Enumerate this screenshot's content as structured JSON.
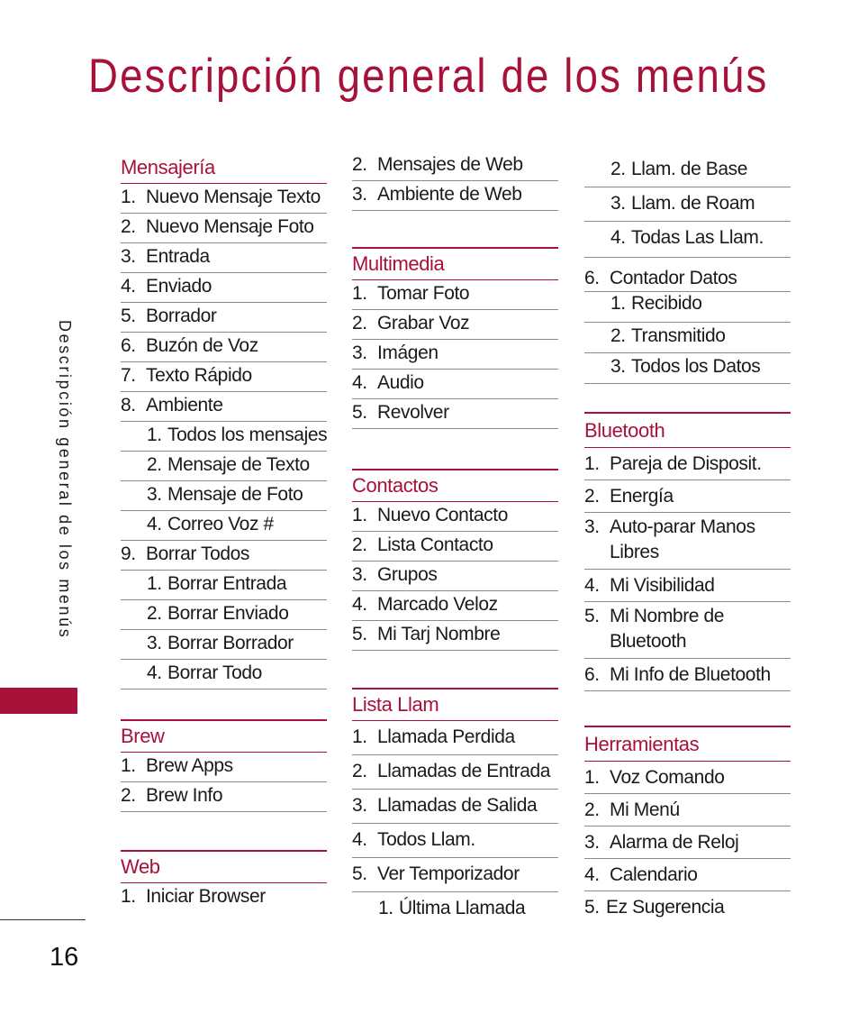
{
  "page": {
    "title": "Descripción general de los menús",
    "side_label": "Descripción general de los menús",
    "page_number": "16",
    "accent_color": "#a8123a"
  },
  "sections": {
    "mensajeria": {
      "title": "Mensajería",
      "items": [
        {
          "num": "1.",
          "label": "Nuevo Mensaje Texto"
        },
        {
          "num": "2.",
          "label": "Nuevo Mensaje Foto"
        },
        {
          "num": "3.",
          "label": "Entrada"
        },
        {
          "num": "4.",
          "label": "Enviado"
        },
        {
          "num": "5.",
          "label": "Borrador"
        },
        {
          "num": "6.",
          "label": "Buzón de Voz"
        },
        {
          "num": "7.",
          "label": "Texto Rápido"
        },
        {
          "num": "8.",
          "label": "Ambiente"
        },
        {
          "num": "1.",
          "label": "Todos los mensajes"
        },
        {
          "num": "2.",
          "label": "Mensaje de Texto"
        },
        {
          "num": "3.",
          "label": "Mensaje de Foto"
        },
        {
          "num": "4.",
          "label": "Correo Voz #"
        },
        {
          "num": "9.",
          "label": "Borrar Todos"
        },
        {
          "num": "1.",
          "label": "Borrar Entrada"
        },
        {
          "num": "2.",
          "label": "Borrar Enviado"
        },
        {
          "num": "3.",
          "label": "Borrar Borrador"
        },
        {
          "num": "4.",
          "label": "Borrar Todo"
        }
      ]
    },
    "brew": {
      "title": "Brew",
      "items": [
        {
          "num": "1.",
          "label": "Brew Apps"
        },
        {
          "num": "2.",
          "label": "Brew Info"
        }
      ]
    },
    "web": {
      "title": "Web",
      "items": [
        {
          "num": "1.",
          "label": "Iniciar Browser"
        },
        {
          "num": "2.",
          "label": "Mensajes de Web"
        },
        {
          "num": "3.",
          "label": "Ambiente de Web"
        }
      ]
    },
    "multimedia": {
      "title": "Multimedia",
      "items": [
        {
          "num": "1.",
          "label": "Tomar Foto"
        },
        {
          "num": "2.",
          "label": "Grabar Voz"
        },
        {
          "num": "3.",
          "label": "Imágen"
        },
        {
          "num": "4.",
          "label": "Audio"
        },
        {
          "num": "5.",
          "label": "Revolver"
        }
      ]
    },
    "contactos": {
      "title": "Contactos",
      "items": [
        {
          "num": "1.",
          "label": "Nuevo Contacto"
        },
        {
          "num": "2.",
          "label": "Lista Contacto"
        },
        {
          "num": "3.",
          "label": "Grupos"
        },
        {
          "num": "4.",
          "label": "Marcado Veloz"
        },
        {
          "num": "5.",
          "label": "Mi Tarj Nombre"
        }
      ]
    },
    "lista_llam": {
      "title": "Lista Llam",
      "items": [
        {
          "num": "1.",
          "label": "Llamada Perdida"
        },
        {
          "num": "2.",
          "label": "Llamadas de Entrada"
        },
        {
          "num": "3.",
          "label": "Llamadas de Salida"
        },
        {
          "num": "4.",
          "label": "Todos Llam."
        },
        {
          "num": "5.",
          "label": "Ver Temporizador"
        },
        {
          "num": "1.",
          "label": "Última Llamada"
        },
        {
          "num": "2.",
          "label": "Llam. de Base"
        },
        {
          "num": "3.",
          "label": "Llam. de Roam"
        },
        {
          "num": "4.",
          "label": "Todas Las Llam."
        },
        {
          "num": "6.",
          "label": "Contador Datos"
        },
        {
          "num": "1.",
          "label": "Recibido"
        },
        {
          "num": "2.",
          "label": "Transmitido"
        },
        {
          "num": "3.",
          "label": "Todos los Datos"
        }
      ]
    },
    "bluetooth": {
      "title": "Bluetooth",
      "items": [
        {
          "num": "1.",
          "label": "Pareja de Disposit."
        },
        {
          "num": "2.",
          "label": "Energía"
        },
        {
          "num": "3.",
          "label": "Auto-parar Manos Libres"
        },
        {
          "num": "4.",
          "label": "Mi Visibilidad"
        },
        {
          "num": "5.",
          "label": "Mi Nombre de Bluetooth"
        },
        {
          "num": "6.",
          "label": "Mi Info de Bluetooth"
        }
      ]
    },
    "herramientas": {
      "title": "Herramientas",
      "items": [
        {
          "num": "1.",
          "label": "Voz Comando"
        },
        {
          "num": "2.",
          "label": "Mi Menú"
        },
        {
          "num": "3.",
          "label": "Alarma de Reloj"
        },
        {
          "num": "4.",
          "label": "Calendario"
        },
        {
          "num": "5.",
          "label": "Ez Sugerencia"
        }
      ]
    }
  }
}
